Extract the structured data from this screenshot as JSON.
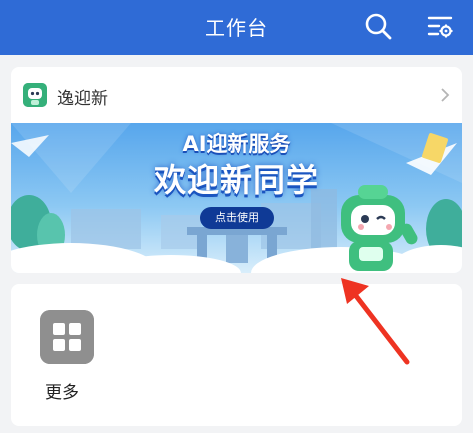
{
  "header": {
    "title": "工作台",
    "background_color": "#2f6bd6",
    "icons": [
      "search-icon",
      "settings-icon"
    ]
  },
  "app_entry": {
    "name": "逸迎新",
    "logo_icon": "robot-mascot-icon",
    "chevron_icon": "chevron-right-icon"
  },
  "banner": {
    "title": "AI迎新服务",
    "subtitle": "欢迎新同学",
    "button_label": "点击使用"
  },
  "shortcuts": {
    "items": [
      {
        "label": "更多",
        "icon": "grid-icon"
      }
    ]
  },
  "annotation": {
    "type": "red-arrow",
    "color": "#ee3322"
  }
}
